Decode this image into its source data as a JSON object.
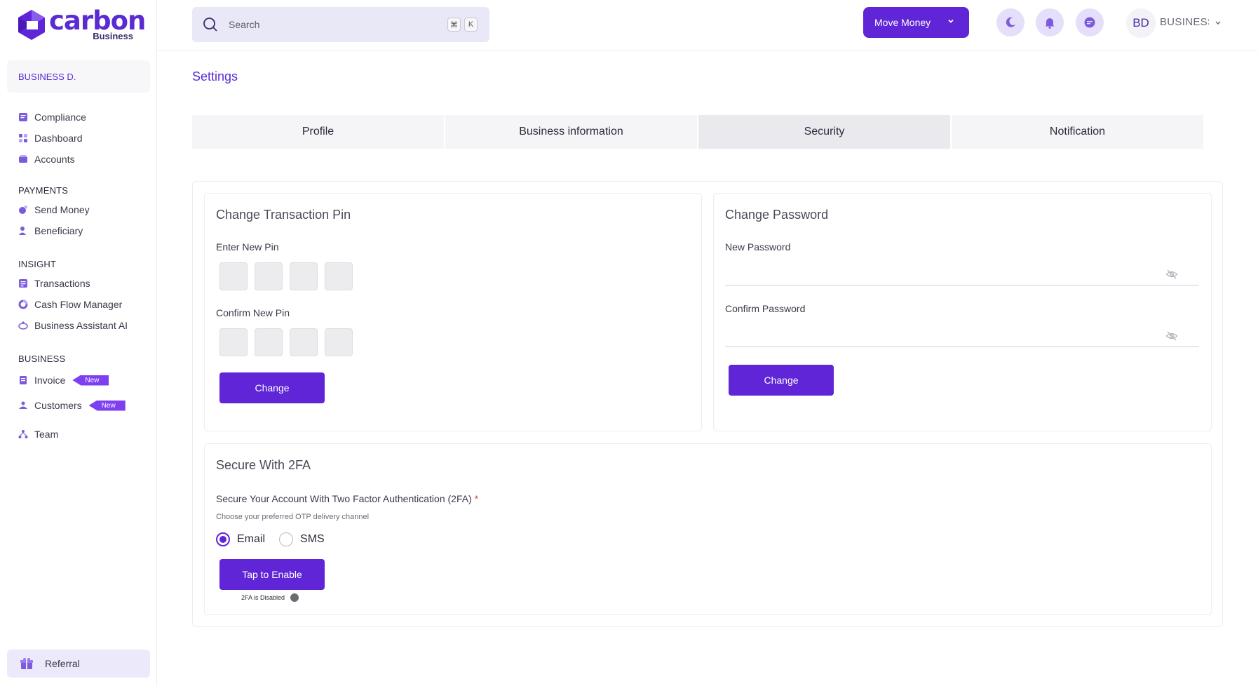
{
  "brand": {
    "name": "carbon",
    "sub": "Business",
    "accent": "#5f25d6"
  },
  "sidebar": {
    "business_name": "BUSINESS D.",
    "items_top": [
      {
        "label": "Compliance",
        "icon": "document-icon"
      },
      {
        "label": "Dashboard",
        "icon": "grid-icon"
      },
      {
        "label": "Accounts",
        "icon": "wallet-icon"
      }
    ],
    "sections": {
      "payments": "PAYMENTS",
      "insight": "INSIGHT",
      "business": "BUSINESS"
    },
    "payments_items": [
      {
        "label": "Send Money",
        "icon": "send-icon"
      },
      {
        "label": "Beneficiary",
        "icon": "user-icon"
      }
    ],
    "insight_items": [
      {
        "label": "Transactions",
        "icon": "list-icon"
      },
      {
        "label": "Cash Flow Manager",
        "icon": "chart-ring-icon"
      },
      {
        "label": "Business Assistant AI",
        "icon": "ai-icon"
      }
    ],
    "business_items": [
      {
        "label": "Invoice",
        "icon": "invoice-icon",
        "badge": "New"
      },
      {
        "label": "Customers",
        "icon": "customers-icon",
        "badge": "New"
      },
      {
        "label": "Team",
        "icon": "team-icon"
      }
    ],
    "referral": "Referral"
  },
  "topbar": {
    "search_placeholder": "Search",
    "kbd_cmd": "⌘",
    "kbd_k": "K",
    "move_money": "Move Money",
    "avatar_initials": "BD",
    "account_name": "BUSINESS D."
  },
  "main": {
    "title": "Settings",
    "tabs": [
      "Profile",
      "Business information",
      "Security",
      "Notification"
    ],
    "active_tab": "Security",
    "pin_card": {
      "title": "Change Transaction Pin",
      "new_pin_label": "Enter New Pin",
      "confirm_pin_label": "Confirm New Pin",
      "button": "Change"
    },
    "password_card": {
      "title": "Change Password",
      "new_label": "New Password",
      "confirm_label": "Confirm Password",
      "button": "Change"
    },
    "twofa_card": {
      "title": "Secure With 2FA",
      "question": "Secure Your Account With Two Factor Authentication (2FA)",
      "required_mark": "*",
      "helper": "Choose your preferred OTP delivery channel",
      "options": [
        "Email",
        "SMS"
      ],
      "selected": "Email",
      "button": "Tap to Enable",
      "status": "2FA is Disabled"
    }
  }
}
